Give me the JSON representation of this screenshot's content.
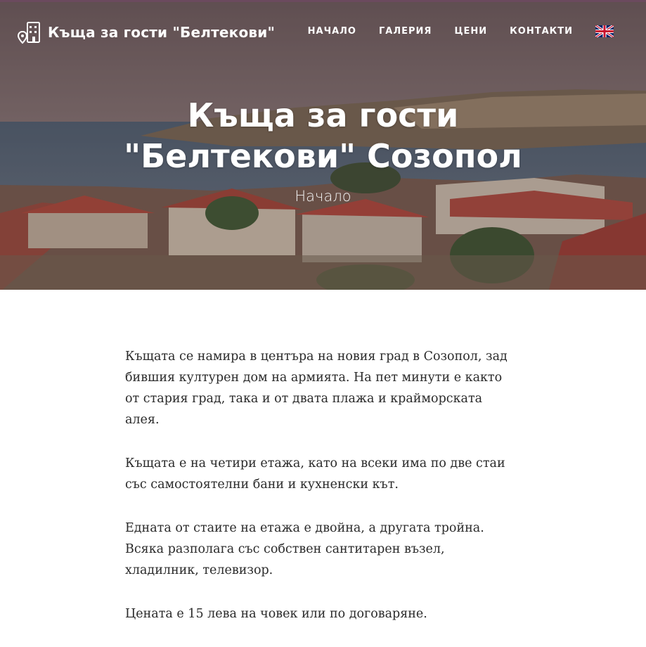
{
  "brand": {
    "title": "Къща за гости \"Белтекови\""
  },
  "nav": {
    "items": [
      {
        "label": "НАЧАЛО"
      },
      {
        "label": "ГАЛЕРИЯ"
      },
      {
        "label": "ЦЕНИ"
      },
      {
        "label": "КОНТАКТИ"
      }
    ],
    "language_icon": "uk-flag-icon"
  },
  "hero": {
    "title": "Къща за гости \"Белтекови\" Созопол",
    "subtitle": "Начало"
  },
  "content": {
    "paragraphs": [
      "Къщата се намира в центъра на новия град в Созопол, зад бившия културен дом на армията. На пет минути е както от стария град, така и от двата плажа и крайморската алея.",
      "Къщата е на четири етажа, като на всеки има по две стаи със самостоятелни бани и кухненски кът.",
      "Едната от стаите на етажа е двойна, а другата тройна. Всяка разполага със собствен сантитарен възел, хладилник, телевизор.",
      "Цената е 15 лева на човек или по договаряне."
    ]
  },
  "colors": {
    "accent": "#6b4a5e",
    "nav_text": "#ffffff",
    "body_text": "#2a2a2a"
  }
}
